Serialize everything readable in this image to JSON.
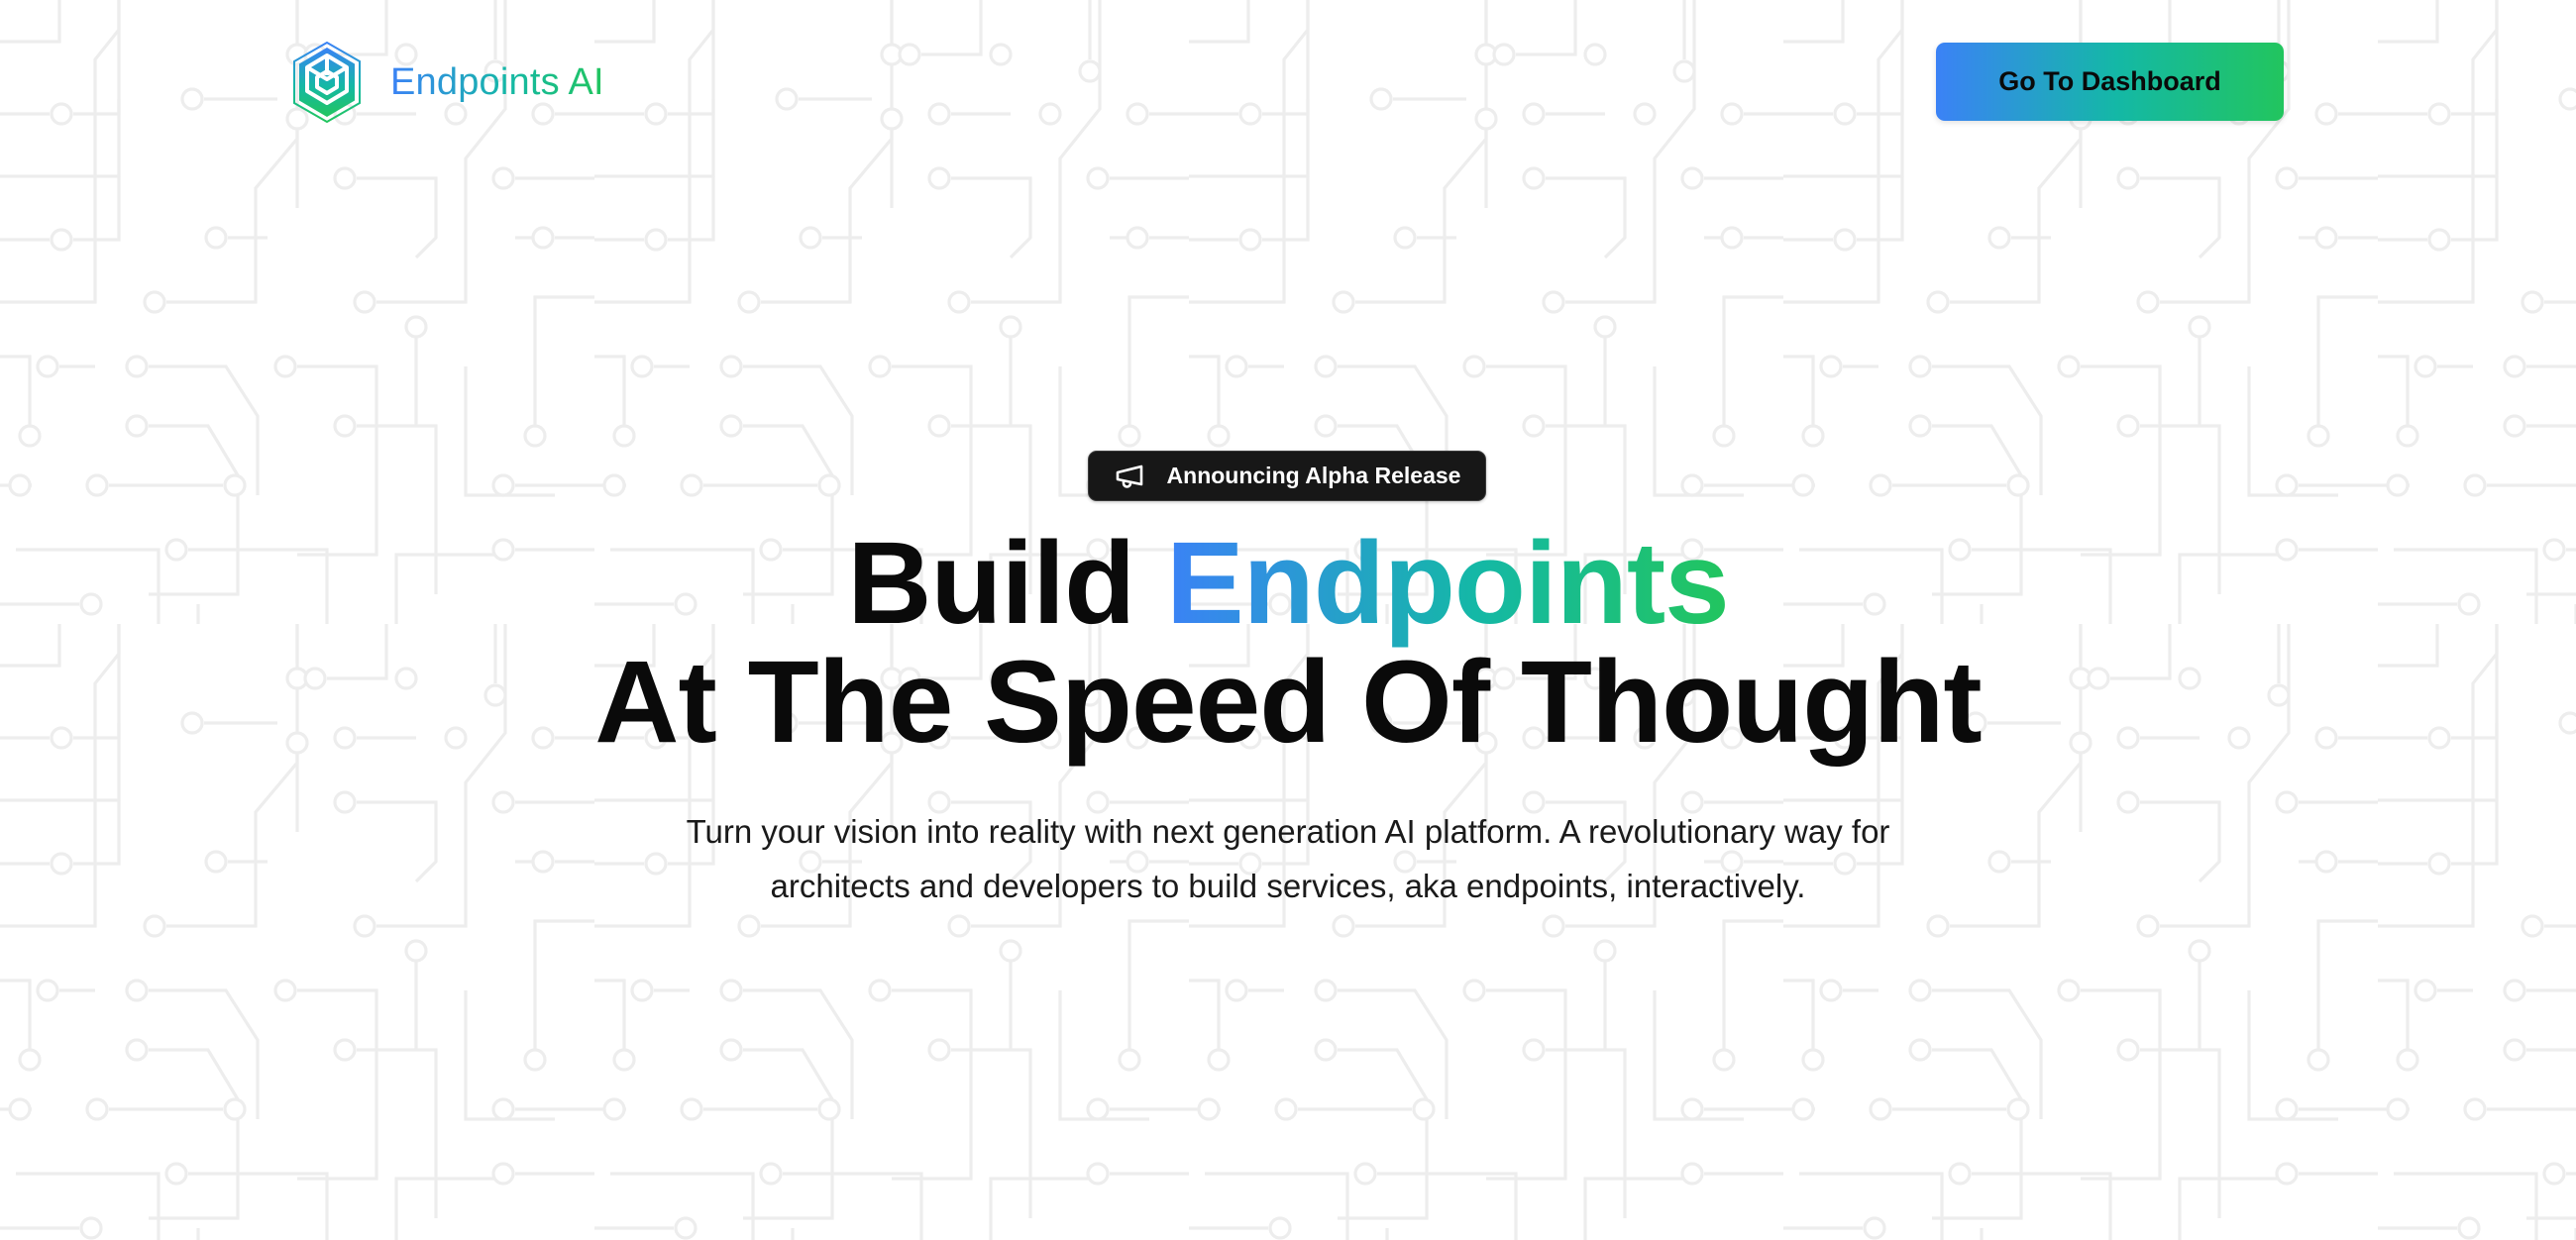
{
  "brand": {
    "name": "Endpoints AI",
    "logo_icon": "hexagon-cube-logo-icon"
  },
  "nav": {
    "cta_label": "Go To Dashboard"
  },
  "announcement": {
    "icon": "megaphone-icon",
    "label": "Announcing Alpha Release"
  },
  "hero": {
    "headline_line1_prefix": "Build",
    "headline_line1_highlight": "Endpoints",
    "headline_line2": "At The Speed Of Thought",
    "subtitle_line1": "Turn your vision into reality with next generation AI platform. A revolutionary way for",
    "subtitle_line2": "architects and developers to build services, aka endpoints, interactively."
  },
  "colors": {
    "gradient_start": "#3b82f6",
    "gradient_mid": "#14b8a6",
    "gradient_end": "#22c55e",
    "text_primary": "#0a0a0a",
    "badge_bg": "#171717",
    "background": "#ffffff",
    "circuit_trace": "#ececec"
  },
  "background": {
    "pattern": "circuit-board"
  }
}
